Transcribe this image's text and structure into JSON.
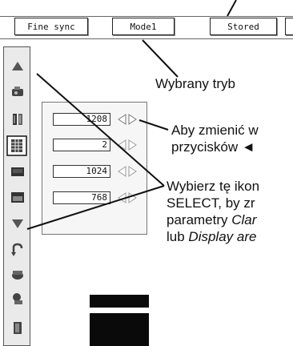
{
  "header": {
    "buttons": [
      "Fine sync",
      "Mode1",
      "Stored"
    ]
  },
  "sidebar": {
    "icons": [
      "up-arrow-icon",
      "projector-icon",
      "tracking-icon",
      "clock-phase-icon",
      "monitor-icon",
      "display-area-icon",
      "down-arrow-icon",
      "reset-icon",
      "store-icon",
      "recall-icon",
      "exit-icon"
    ]
  },
  "panel": {
    "values": [
      "1208",
      "2",
      "1024",
      "768"
    ]
  },
  "callouts": {
    "selected_mode": "Wybrany tryb",
    "change_line1": "Aby zmienić w",
    "change_line2": "przycisków ◄",
    "select_line1": "Wybierz tę ikon",
    "select_line2": "SELECT, by zr",
    "select_line3_prefix": "parametry ",
    "select_line3_italic": "Clar",
    "select_line4_prefix": "lub ",
    "select_line4_italic": "Display are"
  }
}
